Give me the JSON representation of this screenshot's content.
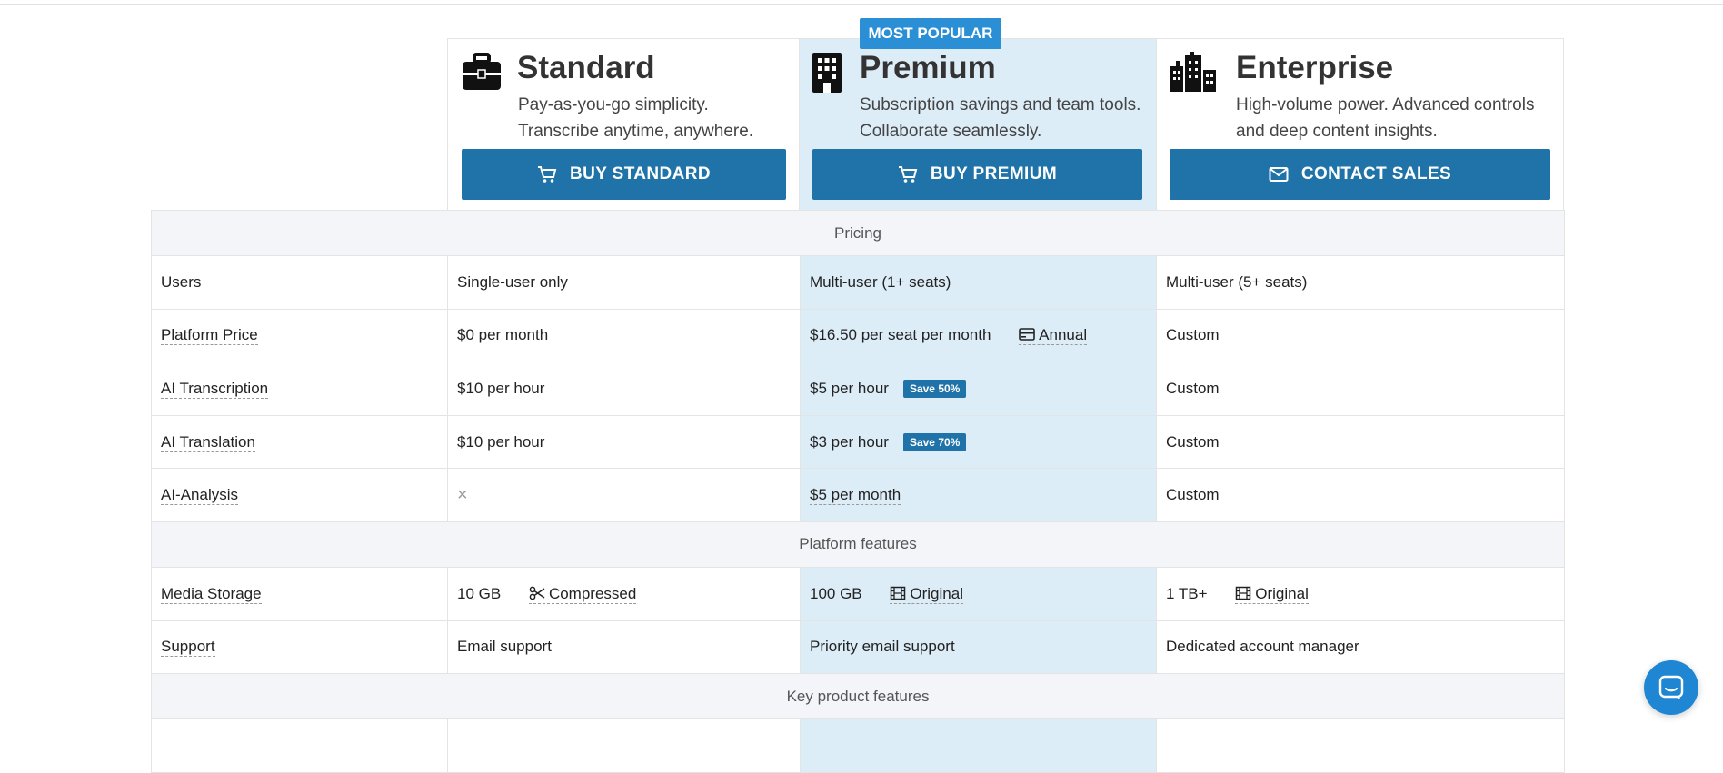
{
  "badge": {
    "most_popular": "MOST POPULAR"
  },
  "plans": {
    "standard": {
      "name": "Standard",
      "desc_line1": "Pay-as-you-go simplicity.",
      "desc_line2": "Transcribe anytime, anywhere.",
      "button": "BUY STANDARD",
      "icon": "briefcase-icon",
      "button_icon": "cart-icon"
    },
    "premium": {
      "name": "Premium",
      "desc_line1": "Subscription savings and team tools.",
      "desc_line2": "Collaborate seamlessly.",
      "button": "BUY PREMIUM",
      "icon": "building-icon",
      "button_icon": "cart-icon"
    },
    "enterprise": {
      "name": "Enterprise",
      "desc_line1": "High-volume power. Advanced controls",
      "desc_line2": "and deep content insights.",
      "button": "CONTACT SALES",
      "icon": "city-icon",
      "button_icon": "envelope-icon"
    }
  },
  "sections": {
    "pricing": "Pricing",
    "platform": "Platform features",
    "key_product": "Key product features"
  },
  "rows": {
    "users": {
      "label": "Users",
      "standard": "Single-user only",
      "premium": "Multi-user (1+ seats)",
      "enterprise": "Multi-user (5+ seats)"
    },
    "platform_price": {
      "label": "Platform Price",
      "standard": "$0 per month",
      "premium": "$16.50 per seat per month",
      "premium_extra": "Annual",
      "enterprise": "Custom"
    },
    "ai_transcription": {
      "label": "AI Transcription",
      "standard": "$10 per hour",
      "premium": "$5 per hour",
      "premium_badge": "Save 50%",
      "enterprise": "Custom"
    },
    "ai_translation": {
      "label": "AI Translation",
      "standard": "$10 per hour",
      "premium": "$3 per hour",
      "premium_badge": "Save 70%",
      "enterprise": "Custom"
    },
    "ai_analysis": {
      "label": "AI-Analysis",
      "standard": "×",
      "premium": "$5 per month",
      "enterprise": "Custom"
    },
    "media_storage": {
      "label": "Media Storage",
      "standard": "10 GB",
      "standard_extra": "Compressed",
      "premium": "100 GB",
      "premium_extra": "Original",
      "enterprise": "1 TB+",
      "enterprise_extra": "Original"
    },
    "support": {
      "label": "Support",
      "standard": "Email support",
      "premium": "Priority email support",
      "enterprise": "Dedicated account manager"
    }
  },
  "colors": {
    "accent": "#1f73a8",
    "badge": "#2b8fd6",
    "premium_bg": "#ddedf8",
    "section_bg": "#f4f5f9",
    "chat": "#1f86d3"
  }
}
